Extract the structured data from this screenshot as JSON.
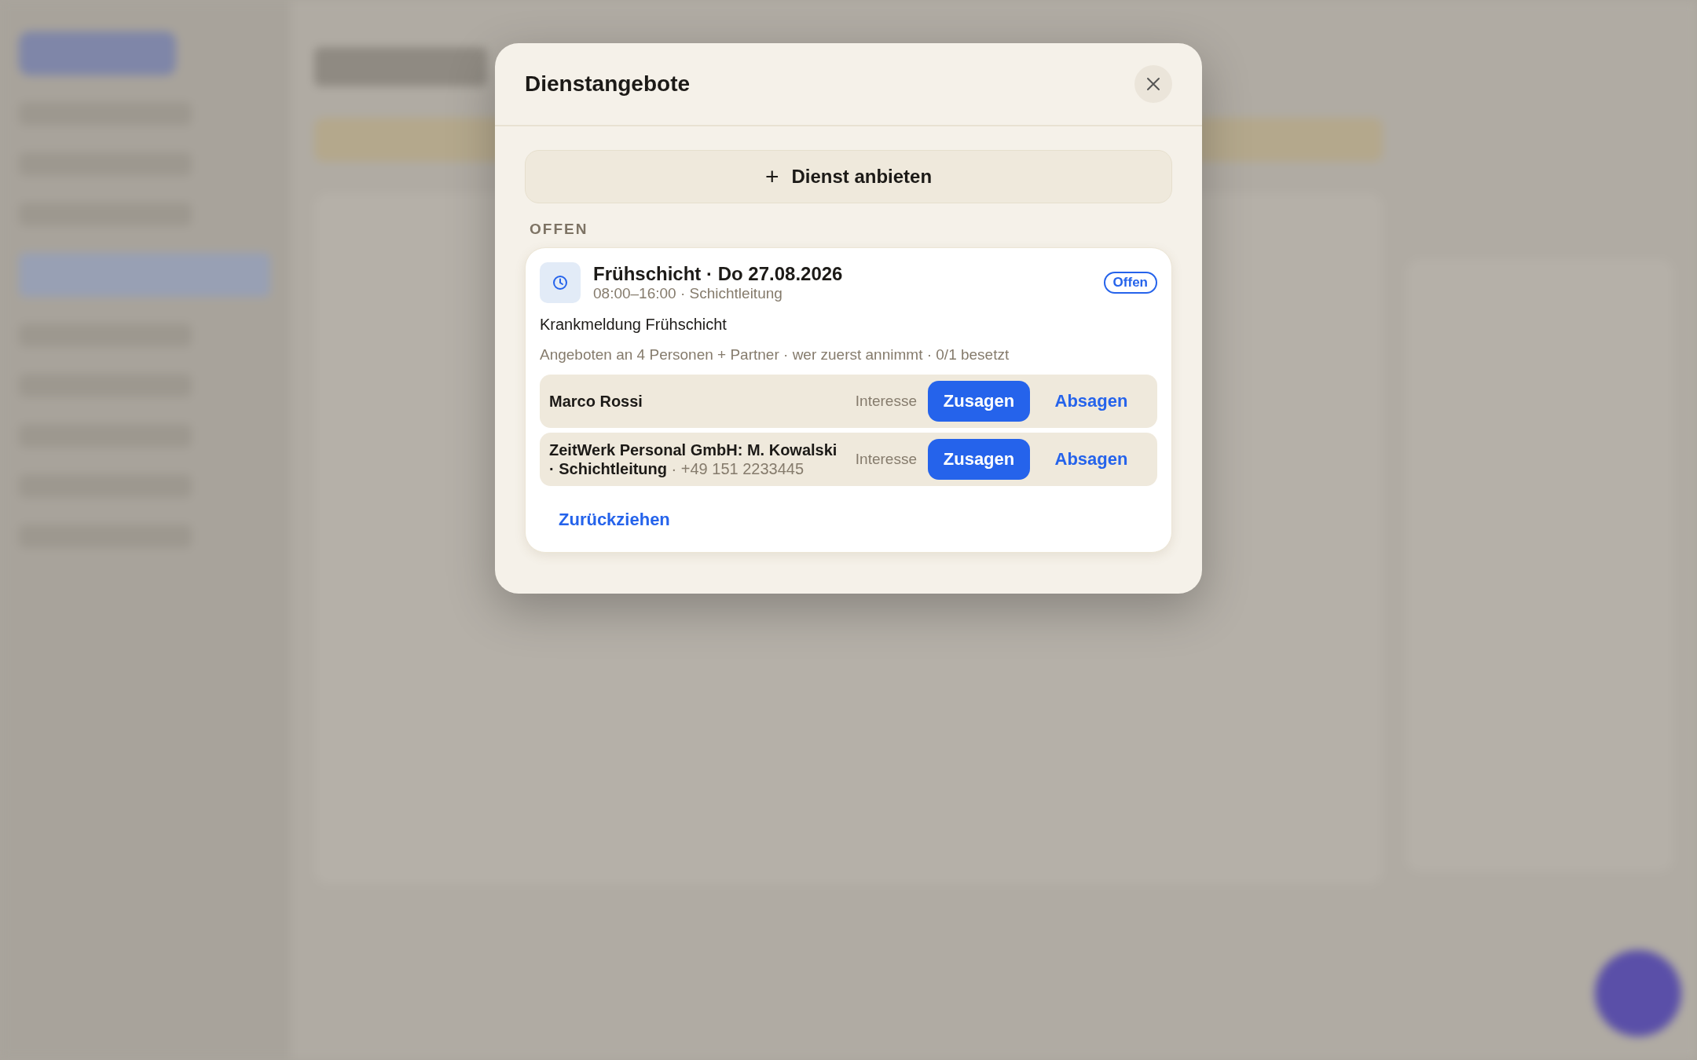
{
  "dialog": {
    "title": "Dienstangebote",
    "offer_button": {
      "icon": "+",
      "label": "Dienst anbieten"
    },
    "sections": [
      {
        "heading": "OFFEN",
        "offers": [
          {
            "title": "Frühschicht · Do 27.08.2026",
            "subtitle": "08:00–16:00 · Schichtleitung",
            "status": "Offen",
            "note": "Krankmeldung Frühschicht",
            "info": "Angeboten an 4 Personen + Partner · wer zuerst annimmt · 0/1 besetzt",
            "responses": [
              {
                "name": "Marco Rossi",
                "label": "Interesse",
                "accept": "Zusagen",
                "decline": "Absagen"
              },
              {
                "name": "ZeitWerk Personal GmbH: M. Kowalski · Schichtleitung",
                "detail": " · +49 151 2233445",
                "label": "Interesse",
                "accept": "Zusagen",
                "decline": "Absagen"
              }
            ],
            "withdraw": "Zurückziehen"
          }
        ]
      }
    ]
  }
}
